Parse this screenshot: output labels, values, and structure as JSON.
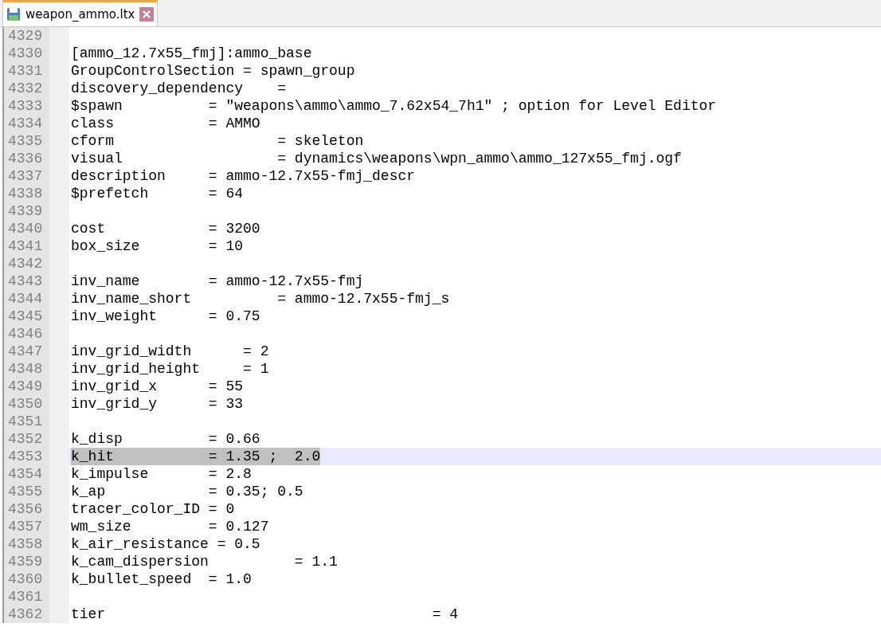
{
  "tabs": [
    {
      "label": "weapon_ammo.ltx",
      "selected": true
    }
  ],
  "editor": {
    "lines": [
      {
        "number": "4329",
        "current": false,
        "selected": false
      },
      {
        "number": "4330",
        "text": "[ammo_12.7x55_fmj]:ammo_base",
        "current": false,
        "selected": false
      },
      {
        "number": "4331",
        "text": "GroupControlSection = spawn_group",
        "current": false,
        "selected": false
      },
      {
        "number": "4332",
        "text": "discovery_dependency    =",
        "current": false,
        "selected": false
      },
      {
        "number": "4333",
        "text": "$spawn          = \"weapons\\ammo\\ammo_7.62x54_7h1\" ; option for Level Editor",
        "current": false,
        "selected": false
      },
      {
        "number": "4334",
        "text": "class           = AMMO",
        "current": false,
        "selected": false
      },
      {
        "number": "4335",
        "text": "cform                   = skeleton",
        "current": false,
        "selected": false
      },
      {
        "number": "4336",
        "text": "visual                  = dynamics\\weapons\\wpn_ammo\\ammo_127x55_fmj.ogf",
        "current": false,
        "selected": false
      },
      {
        "number": "4337",
        "text": "description     = ammo-12.7x55-fmj_descr",
        "current": false,
        "selected": false
      },
      {
        "number": "4338",
        "text": "$prefetch       = 64",
        "current": false,
        "selected": false
      },
      {
        "number": "4339",
        "current": false,
        "selected": false
      },
      {
        "number": "4340",
        "text": "cost            = 3200",
        "current": false,
        "selected": false
      },
      {
        "number": "4341",
        "text": "box_size        = 10",
        "current": false,
        "selected": false
      },
      {
        "number": "4342",
        "current": false,
        "selected": false
      },
      {
        "number": "4343",
        "text": "inv_name        = ammo-12.7x55-fmj",
        "current": false,
        "selected": false
      },
      {
        "number": "4344",
        "text": "inv_name_short          = ammo-12.7x55-fmj_s",
        "current": false,
        "selected": false
      },
      {
        "number": "4345",
        "text": "inv_weight      = 0.75",
        "current": false,
        "selected": false
      },
      {
        "number": "4346",
        "current": false,
        "selected": false
      },
      {
        "number": "4347",
        "text": "inv_grid_width      = 2",
        "current": false,
        "selected": false
      },
      {
        "number": "4348",
        "text": "inv_grid_height     = 1",
        "current": false,
        "selected": false
      },
      {
        "number": "4349",
        "text": "inv_grid_x      = 55",
        "current": false,
        "selected": false
      },
      {
        "number": "4350",
        "text": "inv_grid_y      = 33",
        "current": false,
        "selected": false
      },
      {
        "number": "4351",
        "current": false,
        "selected": false
      },
      {
        "number": "4352",
        "text": "k_disp          = 0.66",
        "current": false,
        "selected": false
      },
      {
        "number": "4353",
        "text": "k_hit           = 1.35 ;  2.0",
        "current": true,
        "selected": true
      },
      {
        "number": "4354",
        "text": "k_impulse       = 2.8",
        "current": false,
        "selected": false
      },
      {
        "number": "4355",
        "text": "k_ap            = 0.35; 0.5",
        "current": false,
        "selected": false
      },
      {
        "number": "4356",
        "text": "tracer_color_ID = 0",
        "current": false,
        "selected": false
      },
      {
        "number": "4357",
        "text": "wm_size         = 0.127",
        "current": false,
        "selected": false
      },
      {
        "number": "4358",
        "text": "k_air_resistance = 0.5",
        "current": false,
        "selected": false
      },
      {
        "number": "4359",
        "text": "k_cam_dispersion          = 1.1",
        "current": false,
        "selected": false
      },
      {
        "number": "4360",
        "text": "k_bullet_speed  = 1.0",
        "current": false,
        "selected": false
      },
      {
        "number": "4361",
        "current": false,
        "selected": false
      },
      {
        "number": "4362",
        "text": "tier                                      = 4",
        "current": false,
        "selected": false
      }
    ]
  }
}
